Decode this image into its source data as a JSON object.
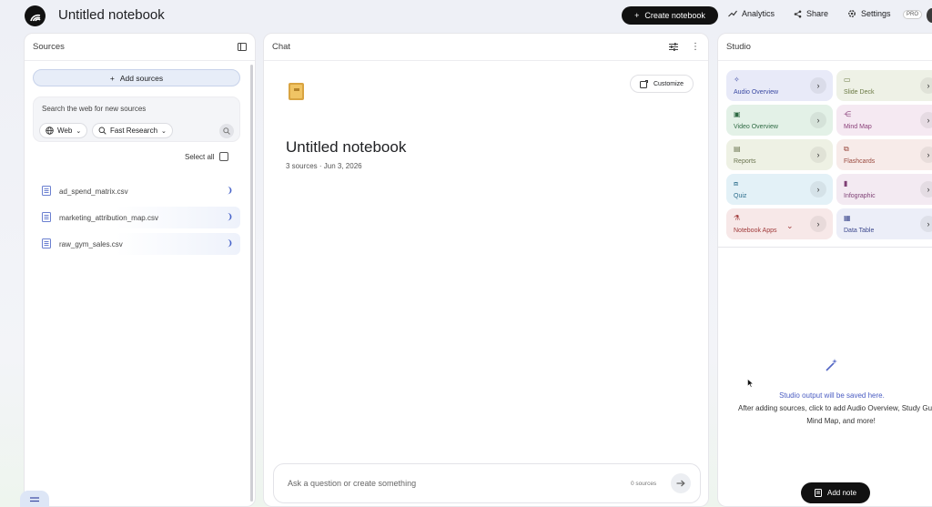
{
  "app": {
    "title": "Untitled notebook"
  },
  "topbar": {
    "create": "Create notebook",
    "analytics": "Analytics",
    "share": "Share",
    "settings": "Settings",
    "pro": "PRO"
  },
  "sources": {
    "header": "Sources",
    "add": "Add sources",
    "search_hint": "Search the web for new sources",
    "web_chip": "Web",
    "research_chip": "Fast Research",
    "select_all": "Select all",
    "items": [
      {
        "name": "ad_spend_matrix.csv"
      },
      {
        "name": "marketing_attribution_map.csv"
      },
      {
        "name": "raw_gym_sales.csv"
      }
    ]
  },
  "chat": {
    "header": "Chat",
    "customize": "Customize",
    "notebook_title": "Untitled notebook",
    "meta": "3 sources · Jun 3, 2026",
    "input_placeholder": "Ask a question or create something",
    "source_count": "0 sources"
  },
  "studio": {
    "header": "Studio",
    "cards": [
      {
        "label": "Audio Overview",
        "color": "#e8eaf8",
        "text": "#3b4aa3",
        "icon": "sparkle-icon"
      },
      {
        "label": "Slide Deck",
        "color": "#eef1e6",
        "text": "#6c7a45",
        "icon": "slides-icon"
      },
      {
        "label": "Video Overview",
        "color": "#e3f1e7",
        "text": "#2f6b44",
        "icon": "video-icon"
      },
      {
        "label": "Mind Map",
        "color": "#f5e9f2",
        "text": "#8a3f79",
        "icon": "mindmap-icon"
      },
      {
        "label": "Reports",
        "color": "#eef1e4",
        "text": "#6b7550",
        "icon": "reports-icon"
      },
      {
        "label": "Flashcards",
        "color": "#f7ebe9",
        "text": "#9a4a3f",
        "icon": "flashcards-icon"
      },
      {
        "label": "Quiz",
        "color": "#e3f1f7",
        "text": "#2e6f8d",
        "icon": "quiz-icon"
      },
      {
        "label": "Infographic",
        "color": "#f3eaf2",
        "text": "#7e3f74",
        "icon": "infographic-icon"
      },
      {
        "label": "Notebook Apps",
        "color": "#f7e8e8",
        "text": "#a03a3a",
        "icon": "flask-icon"
      },
      {
        "label": "Data Table",
        "color": "#eceef8",
        "text": "#3e4a8f",
        "icon": "table-icon"
      }
    ],
    "empty_title": "Studio output will be saved here.",
    "empty_desc": "After adding sources, click to add Audio Overview, Study Guide, Mind Map, and more!",
    "add_note": "Add note"
  }
}
